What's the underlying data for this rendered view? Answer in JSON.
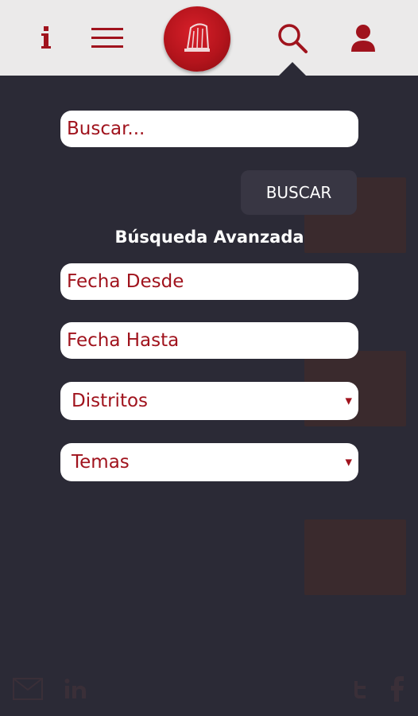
{
  "header": {
    "info_icon": "info-icon",
    "menu_icon": "hamburger-menu-icon",
    "logo": "site-logo",
    "search_icon": "search-icon",
    "user_icon": "user-icon",
    "accent_color": "#a0131d"
  },
  "search": {
    "placeholder": "Buscar...",
    "button_label": "BUSCAR",
    "advanced_title": "Búsqueda Avanzada",
    "date_from_placeholder": "Fecha Desde",
    "date_to_placeholder": "Fecha Hasta",
    "districts_selected": "Distritos",
    "topics_selected": "Temas"
  }
}
